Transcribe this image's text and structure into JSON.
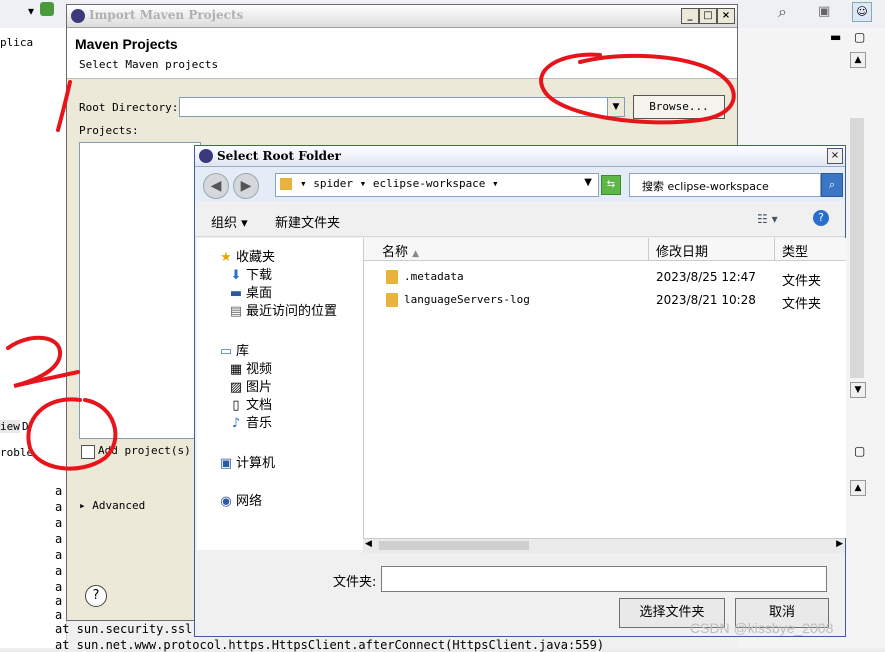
{
  "background": {
    "left_tab": "plica",
    "left_tabs": [
      "iew",
      "D",
      "roble"
    ],
    "console_lines": [
      "a",
      "a",
      "a",
      "a",
      "a",
      "a",
      "a",
      "a",
      "a",
      "at sun.security.ssl",
      "at sun.net.www.protocol.https.HttpsClient.afterConnect(HttpsClient.java:559)"
    ]
  },
  "import_dialog": {
    "title": "Import Maven Projects",
    "header_title": "Maven Projects",
    "header_subtitle": "Select Maven projects",
    "root_directory_label": "Root Directory:",
    "browse_label": "Browse...",
    "projects_label": "Projects:",
    "add_project_label": "Add project(s)",
    "advanced_label": "Advanced",
    "help_glyph": "?"
  },
  "folder_dialog": {
    "title": "Select Root Folder",
    "address_path": "▾ spider ▾ eclipse-workspace ▾",
    "search_text": "搜索 eclipse-workspace",
    "organize_label": "组织 ▾",
    "new_folder_label": "新建文件夹",
    "nav": {
      "favorites": "收藏夹",
      "downloads": "下载",
      "desktop": "桌面",
      "recent": "最近访问的位置",
      "libraries": "库",
      "videos": "视频",
      "pictures": "图片",
      "documents": "文档",
      "music": "音乐",
      "computer": "计算机",
      "network": "网络"
    },
    "columns": {
      "name": "名称",
      "modified": "修改日期",
      "type": "类型"
    },
    "files": [
      {
        "name": ".metadata",
        "modified": "2023/8/25 12:47",
        "type": "文件夹"
      },
      {
        "name": "languageServers-log",
        "modified": "2023/8/21 10:28",
        "type": "文件夹"
      }
    ],
    "folder_label": "文件夹:",
    "folder_value": "",
    "select_button": "选择文件夹",
    "cancel_button": "取消"
  },
  "annotations": {
    "label_1": "1",
    "label_2": "2",
    "color": "#e8141c"
  },
  "watermark": "CSDN @kissbye_2008"
}
